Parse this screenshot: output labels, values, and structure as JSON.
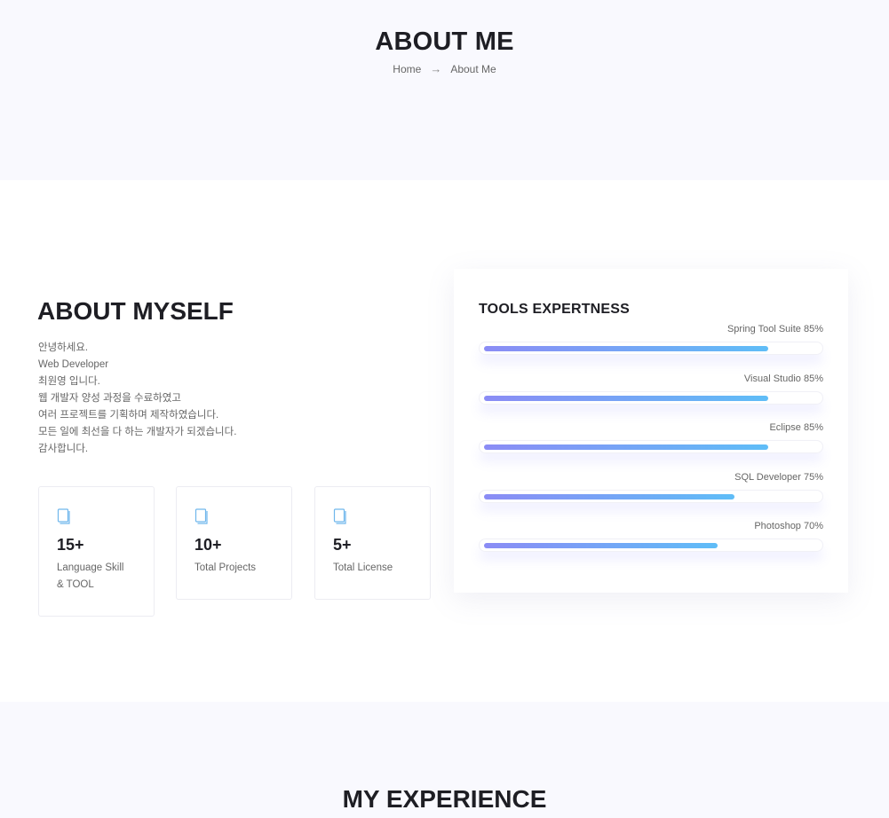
{
  "hero": {
    "title": "ABOUT ME",
    "breadcrumb": {
      "home": "Home",
      "arrow": "→",
      "current": "About Me"
    }
  },
  "about": {
    "title": "ABOUT MYSELF",
    "intro": [
      "안녕하세요.",
      "Web Developer",
      "최원영 입니다.",
      "웹 개발자 양성 과정을 수료하였고",
      "여러 프로젝트를 기획하며 제작하였습니다.",
      "모든 일에 최선을 다 하는 개발자가 되겠습니다.",
      "감사합니다."
    ],
    "stats": [
      {
        "icon": "book-icon",
        "value": "15+",
        "label": "Language Skill & TOOL"
      },
      {
        "icon": "book-icon",
        "value": "10+",
        "label": "Total Projects"
      },
      {
        "icon": "book-icon",
        "value": "5+",
        "label": "Total License"
      }
    ]
  },
  "tools": {
    "title": "TOOLS EXPERTNESS",
    "skills": [
      {
        "label": "Spring Tool Suite 85%",
        "percent": 85
      },
      {
        "label": "Visual Studio 85%",
        "percent": 85
      },
      {
        "label": "Eclipse 85%",
        "percent": 85
      },
      {
        "label": "SQL Developer 75%",
        "percent": 75
      },
      {
        "label": "Photoshop 70%",
        "percent": 70
      }
    ],
    "bar_gradient": [
      "#8b8cf5",
      "#5fbdf7"
    ]
  },
  "experience": {
    "title": "MY EXPERIENCE"
  }
}
